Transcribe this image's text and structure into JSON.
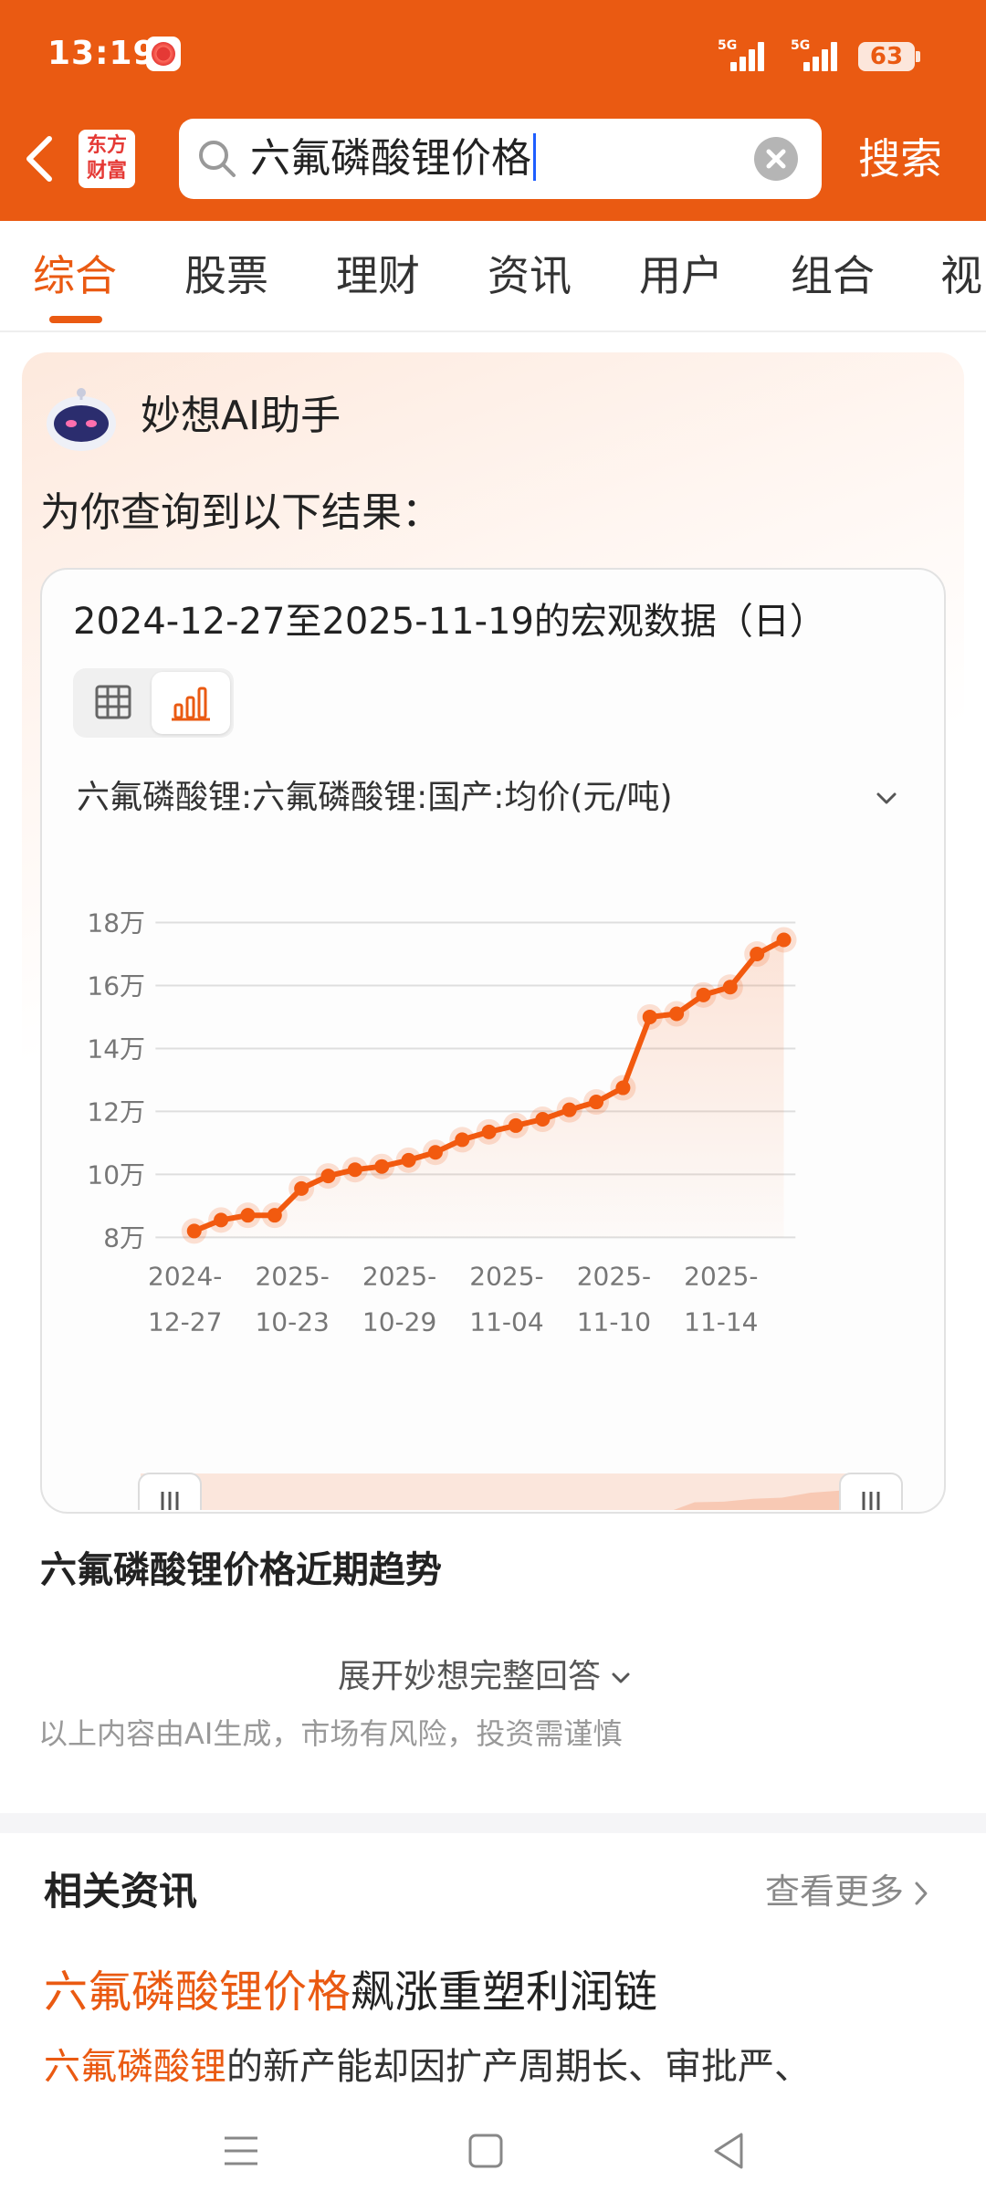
{
  "status_bar": {
    "time": "13:19",
    "signal1": "5G",
    "signal2": "5G",
    "battery": "63"
  },
  "header": {
    "logo_line1": "东方",
    "logo_line2": "财富",
    "search_query": "六氟磷酸锂价格",
    "search_button": "搜索"
  },
  "tabs": [
    "综合",
    "股票",
    "理财",
    "资讯",
    "用户",
    "组合",
    "视"
  ],
  "active_tab": 0,
  "ai": {
    "assistant_name": "妙想AI助手",
    "intro": "为你查询到以下结果："
  },
  "chart_card": {
    "heading": "2024-12-27至2025-11-19的宏观数据（日）",
    "series_selector": "六氟磷酸锂:六氟磷酸锂:国产:均价(元/吨)"
  },
  "chart_data": {
    "type": "line",
    "title": "",
    "xlabel": "",
    "ylabel": "",
    "ylim": [
      80000,
      180000
    ],
    "yticks": [
      80000,
      100000,
      120000,
      140000,
      160000,
      180000
    ],
    "ytick_labels": [
      "8万",
      "10万",
      "12万",
      "14万",
      "16万",
      "18万"
    ],
    "x_tick_labels": [
      {
        "index": 0,
        "line1": "2024-",
        "line2": "12-27"
      },
      {
        "index": 4,
        "line1": "2025-",
        "line2": "10-23"
      },
      {
        "index": 8,
        "line1": "2025-",
        "line2": "10-29"
      },
      {
        "index": 12,
        "line1": "2025-",
        "line2": "11-04"
      },
      {
        "index": 16,
        "line1": "2025-",
        "line2": "11-10"
      },
      {
        "index": 20,
        "line1": "2025-",
        "line2": "11-14"
      }
    ],
    "series": [
      {
        "color": "#f25a0f",
        "values": [
          82000,
          85500,
          87000,
          87000,
          95500,
          99500,
          101500,
          102500,
          104500,
          107000,
          111000,
          113500,
          115500,
          117500,
          120500,
          123000,
          127500,
          150000,
          151000,
          157000,
          159500,
          170000,
          174500
        ]
      }
    ],
    "grid": true
  },
  "answer": {
    "trend_title": "六氟磷酸锂价格近期趋势",
    "expand_label": "展开妙想完整回答",
    "disclaimer": "以上内容由AI生成，市场有风险，投资需谨慎"
  },
  "news": {
    "section_title": "相关资讯",
    "more_label": "查看更多",
    "title_highlight": "六氟磷酸锂价格",
    "title_rest": "飙涨重塑利润链",
    "body_highlight": "六氟磷酸锂",
    "body_rest": "的新产能却因扩产周期长、审批严、"
  },
  "colors": {
    "brand": "#ea5a12",
    "line": "#f25a0f"
  }
}
